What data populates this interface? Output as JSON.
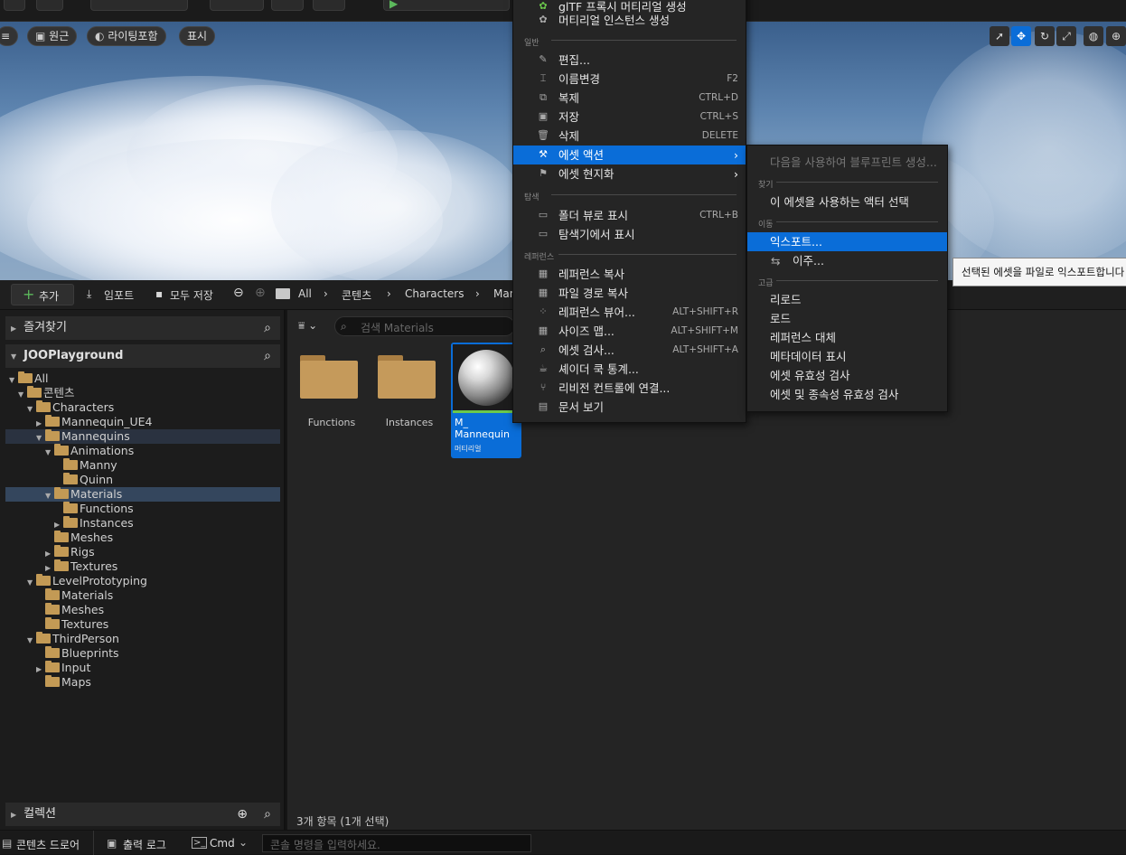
{
  "viewport": {
    "perspective": "원근",
    "lighting": "라이팅포함",
    "show": "표시"
  },
  "toolbar": {
    "add": "추가",
    "import": "임포트",
    "save_all": "모두 저장",
    "breadcrumb": [
      "All",
      "콘텐츠",
      "Characters",
      "Man"
    ]
  },
  "left": {
    "favorites": "즐겨찾기",
    "project": "JOOPlayground",
    "collections": "컬렉션",
    "tree": [
      {
        "label": "All",
        "depth": 0,
        "open": true
      },
      {
        "label": "콘텐츠",
        "depth": 1,
        "open": true
      },
      {
        "label": "Characters",
        "depth": 2,
        "open": true
      },
      {
        "label": "Mannequin_UE4",
        "depth": 3,
        "open": false,
        "collapsed": true
      },
      {
        "label": "Mannequins",
        "depth": 3,
        "open": true
      },
      {
        "label": "Animations",
        "depth": 4,
        "open": true
      },
      {
        "label": "Manny",
        "depth": 5
      },
      {
        "label": "Quinn",
        "depth": 5
      },
      {
        "label": "Materials",
        "depth": 4,
        "open": true
      },
      {
        "label": "Functions",
        "depth": 5
      },
      {
        "label": "Instances",
        "depth": 5,
        "collapsed": true
      },
      {
        "label": "Meshes",
        "depth": 4
      },
      {
        "label": "Rigs",
        "depth": 4,
        "collapsed": true
      },
      {
        "label": "Textures",
        "depth": 4,
        "collapsed": true
      },
      {
        "label": "LevelPrototyping",
        "depth": 2,
        "open": true
      },
      {
        "label": "Materials",
        "depth": 3
      },
      {
        "label": "Meshes",
        "depth": 3
      },
      {
        "label": "Textures",
        "depth": 3
      },
      {
        "label": "ThirdPerson",
        "depth": 2,
        "open": true
      },
      {
        "label": "Blueprints",
        "depth": 3
      },
      {
        "label": "Input",
        "depth": 3,
        "collapsed": true
      },
      {
        "label": "Maps",
        "depth": 3
      }
    ]
  },
  "right": {
    "search_placeholder": "검색 Materials",
    "status": "3개 항목 (1개 선택)",
    "assets": [
      {
        "name": "Functions"
      },
      {
        "name": "Instances"
      },
      {
        "name": "M_\nMannequin",
        "type": "머티리얼"
      }
    ]
  },
  "context_menu": {
    "top_items": [
      "glTF 프록시 머티리얼 생성",
      "머티리얼 인스턴스 생성"
    ],
    "sections": {
      "general": "일반",
      "explore": "탐색",
      "references": "레퍼런스"
    },
    "general": [
      {
        "label": "편집...",
        "shortcut": ""
      },
      {
        "label": "이름변경",
        "shortcut": "F2"
      },
      {
        "label": "복제",
        "shortcut": "CTRL+D"
      },
      {
        "label": "저장",
        "shortcut": "CTRL+S"
      },
      {
        "label": "삭제",
        "shortcut": "DELETE"
      },
      {
        "label": "에셋 액션",
        "shortcut": ""
      },
      {
        "label": "에셋 현지화",
        "shortcut": ""
      }
    ],
    "explore": [
      {
        "label": "폴더 뷰로 표시",
        "shortcut": "CTRL+B"
      },
      {
        "label": "탐색기에서 표시",
        "shortcut": ""
      }
    ],
    "references": [
      {
        "label": "레퍼런스 복사",
        "shortcut": ""
      },
      {
        "label": "파일 경로 복사",
        "shortcut": ""
      },
      {
        "label": "레퍼런스 뷰어...",
        "shortcut": "ALT+SHIFT+R"
      },
      {
        "label": "사이즈 맵...",
        "shortcut": "ALT+SHIFT+M"
      },
      {
        "label": "에셋 검사...",
        "shortcut": "ALT+SHIFT+A"
      },
      {
        "label": "셰이더 쿡 통계...",
        "shortcut": ""
      },
      {
        "label": "리비전 컨트롤에 연결...",
        "shortcut": ""
      },
      {
        "label": "문서 보기",
        "shortcut": ""
      }
    ]
  },
  "submenu": {
    "disabled": "다음을 사용하여 블루프린트 생성...",
    "sections": {
      "find": "찾기",
      "move": "이동",
      "advanced": "고급"
    },
    "find": [
      "이 에셋을 사용하는 액터 선택"
    ],
    "move": [
      "익스포트...",
      "이주..."
    ],
    "advanced": [
      "리로드",
      "로드",
      "레퍼런스 대체",
      "메타데이터 표시",
      "에셋 유효성 검사",
      "에셋 및 종속성 유효성 검사"
    ]
  },
  "tooltip": "선택된 에셋을 파일로 익스포트합니다",
  "statusbar": {
    "content_drawer": "콘텐츠 드로어",
    "output_log": "출력 로그",
    "cmd": "Cmd",
    "console_placeholder": "콘솔 명령을 입력하세요."
  }
}
